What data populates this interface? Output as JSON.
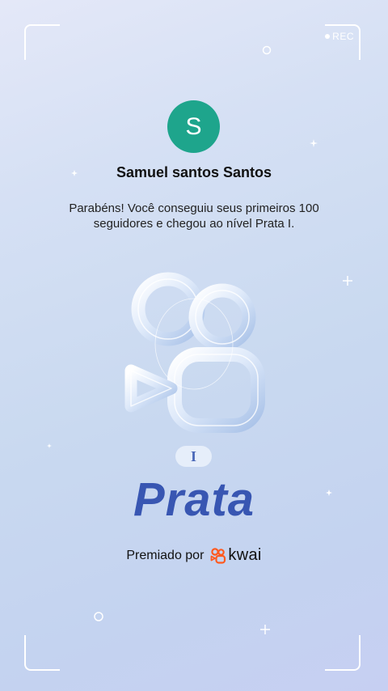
{
  "recorder": {
    "rec_label": "REC"
  },
  "profile": {
    "avatar_initial": "S",
    "name": "Samuel santos Santos"
  },
  "message": {
    "text": "Parabéns! Você conseguiu seus primeiros 100 seguidores e chegou ao nível Prata I."
  },
  "badge": {
    "level_roman": "I",
    "level_name": "Prata"
  },
  "footer": {
    "awarded_by": "Premiado por",
    "brand": "kwai"
  },
  "colors": {
    "avatar_bg": "#1ea58c",
    "level_text": "#3856b2",
    "brand_orange": "#ff5a1f"
  }
}
